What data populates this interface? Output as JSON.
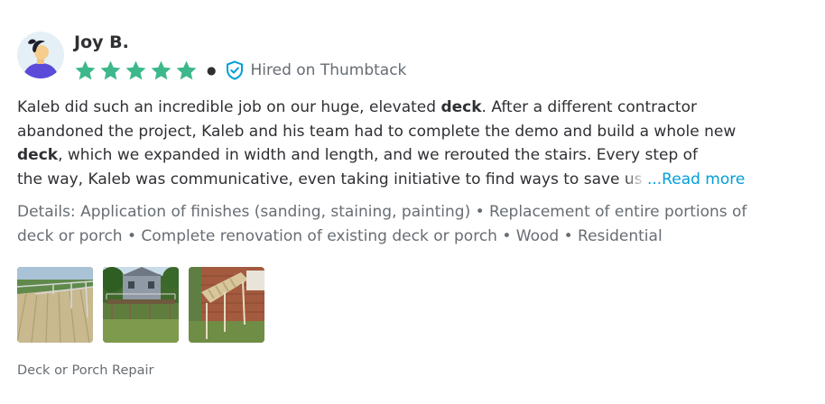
{
  "reviewer": {
    "name": "Joy B.",
    "avatar_icon": "user-avatar-icon",
    "rating": 5,
    "rating_max": 5,
    "star_color": "#3cb88b",
    "hired_text": "Hired on Thumbtack",
    "hired_icon": "shield-check-icon"
  },
  "review": {
    "p1": "Kaleb did such an incredible job on our huge, elevated ",
    "b1": "deck",
    "p2": ". After a different contractor abandoned the project, Kaleb and his team had to complete the demo and build a whole new ",
    "b2": "deck",
    "p3": ", which we expanded in width and length, and we rerouted the stairs. Every step of ",
    "p4": "the way, Kaleb was communicative, even taking initiative to find ways to save ",
    "faded": "us",
    "read_more": "...Read more"
  },
  "details": "Details: Application of finishes (sanding, staining, painting) • Replacement of entire portions of deck or porch • Complete renovation of existing deck or porch • Wood • Residential",
  "photos": [
    {
      "name": "deck-photo-1"
    },
    {
      "name": "deck-photo-2"
    },
    {
      "name": "deck-photo-3"
    }
  ],
  "category": "Deck or Porch Repair",
  "colors": {
    "text": "#2f3033",
    "muted": "#676d73",
    "link": "#009fd9",
    "shield": "#009fd9",
    "star": "#3cb88b"
  }
}
